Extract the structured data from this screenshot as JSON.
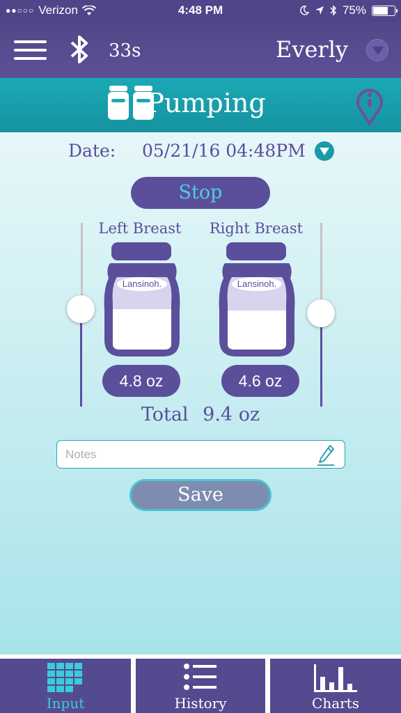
{
  "status_bar": {
    "signal": "●●○○○",
    "carrier": "Verizon",
    "time": "4:48 PM",
    "battery_percent": "75%",
    "battery_level": 0.75
  },
  "header": {
    "timer": "33s",
    "user_name": "Everly"
  },
  "title_bar": {
    "title": "Pumping"
  },
  "session": {
    "date_label": "Date:",
    "date_value": "05/21/16 04:48PM",
    "stop_label": "Stop",
    "left": {
      "label": "Left Breast",
      "volume": "4.8 oz",
      "brand": "Lansinoh.",
      "fill_level": 0.48,
      "slider_level": 0.44
    },
    "right": {
      "label": "Right Breast",
      "volume": "4.6 oz",
      "brand": "Lansinoh.",
      "fill_level": 0.46,
      "slider_level": 0.48
    },
    "total_label": "Total",
    "total_value": "9.4 oz"
  },
  "notes": {
    "placeholder": "Notes",
    "value": ""
  },
  "save_label": "Save",
  "tabs": [
    {
      "label": "Input",
      "active": true
    },
    {
      "label": "History",
      "active": false
    },
    {
      "label": "Charts",
      "active": false
    }
  ],
  "colors": {
    "brand_purple": "#5b4f9c",
    "accent_teal": "#1ba9b5",
    "active_tab_text": "#3ccbd8"
  }
}
